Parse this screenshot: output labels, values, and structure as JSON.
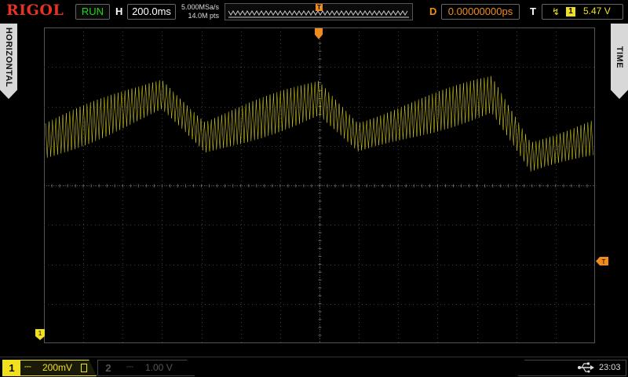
{
  "brand": "RIGOL",
  "status": {
    "run_label": "RUN",
    "run_color": "#1fd61f"
  },
  "horizontal": {
    "letter": "H",
    "timebase": "200.0ms",
    "sample_rate": "5.000MSa/s",
    "memory_depth": "14.0M pts",
    "trigger_position_label": "T"
  },
  "delay": {
    "letter": "D",
    "value": "0.00000000ps"
  },
  "trigger": {
    "letter": "T",
    "edge_icon": "rising-edge-icon",
    "source": "1",
    "level": "5.47 V",
    "marker_label": "T"
  },
  "side_tabs": {
    "left": "HORIZONTAL",
    "right": "TIME"
  },
  "channels": [
    {
      "number": "1",
      "coupling_icon": "dc-coupling-icon",
      "scale": "200mV",
      "bw_limit_icon": "bandwidth-limit-icon",
      "active": true,
      "color": "#f0e01e"
    },
    {
      "number": "2",
      "coupling_icon": "dc-coupling-icon",
      "scale": "1.00 V",
      "active": false,
      "color": "#555555"
    }
  ],
  "ground_marker_label": "1",
  "system": {
    "usb_icon": "usb-icon",
    "clock": "23:03"
  },
  "colors": {
    "accent_orange": "#f08c1e",
    "ch1_yellow": "#f0e01e",
    "grid": "#3a3a3a"
  }
}
